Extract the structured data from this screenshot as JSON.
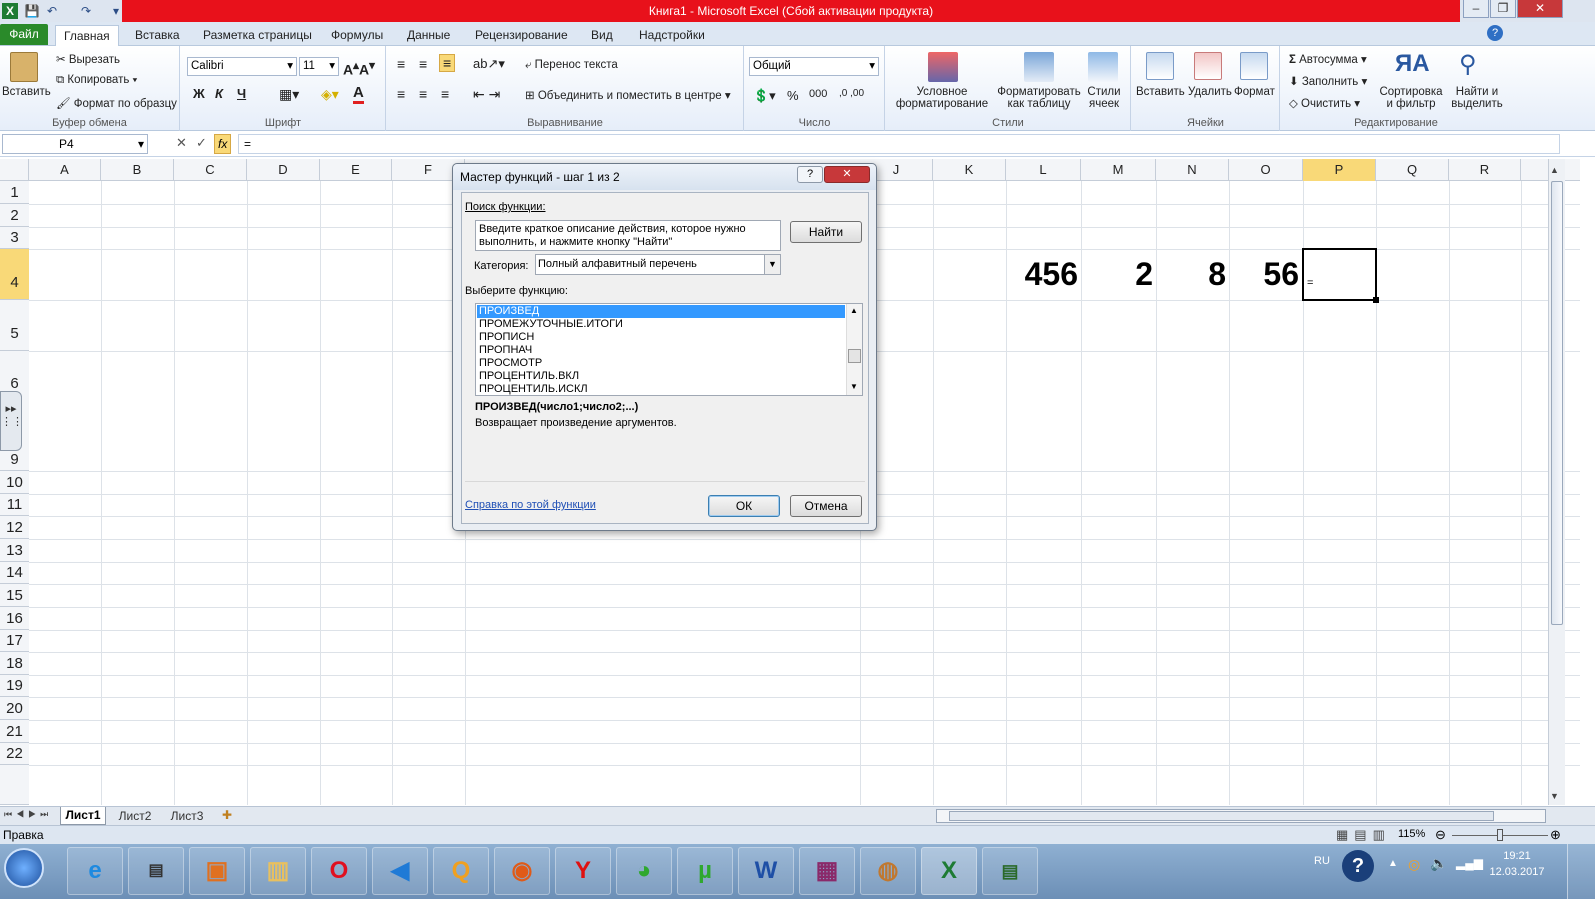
{
  "window": {
    "title": "Книга1  -  Microsoft Excel (Сбой активации продукта)"
  },
  "ribbon_tabs": [
    "Файл",
    "Главная",
    "Вставка",
    "Разметка страницы",
    "Формулы",
    "Данные",
    "Рецензирование",
    "Вид",
    "Надстройки"
  ],
  "clipboard": {
    "paste": "Вставить",
    "cut": "Вырезать",
    "copy": "Копировать",
    "format_painter": "Формат по образцу",
    "label": "Буфер обмена"
  },
  "font": {
    "name": "Calibri",
    "size": "11",
    "bold": "Ж",
    "italic": "К",
    "underline": "Ч",
    "label": "Шрифт"
  },
  "alignment": {
    "wrap": "Перенос текста",
    "merge": "Объединить и поместить в центре",
    "label": "Выравнивание"
  },
  "number": {
    "format": "Общий",
    "percent": "%",
    "thousands": "000",
    "label": "Число"
  },
  "styles": {
    "conditional": "Условное форматирование",
    "as_table": "Форматировать как таблицу",
    "cell_styles": "Стили ячеек",
    "label": "Стили"
  },
  "cells": {
    "insert": "Вставить",
    "delete": "Удалить",
    "format": "Формат",
    "label": "Ячейки"
  },
  "editing": {
    "autosum": "Автосумма",
    "fill": "Заполнить",
    "clear": "Очистить",
    "sort": "Сортировка и фильтр",
    "find": "Найти и выделить",
    "label": "Редактирование"
  },
  "formula_bar": {
    "name_box": "P4",
    "fx": "fx",
    "formula": "="
  },
  "columns": [
    "A",
    "B",
    "C",
    "D",
    "E",
    "F",
    "J",
    "K",
    "L",
    "M",
    "N",
    "O",
    "P",
    "Q",
    "R"
  ],
  "rows": [
    "1",
    "2",
    "3",
    "4",
    "5",
    "6",
    "9",
    "10",
    "11",
    "12",
    "13",
    "14",
    "15",
    "16",
    "17",
    "18",
    "19",
    "20",
    "21",
    "22"
  ],
  "cells_data": {
    "L4": "456",
    "M4": "2",
    "N4": "8",
    "O4": "56",
    "P4": "="
  },
  "dialog": {
    "title": "Мастер функций - шаг 1 из 2",
    "help_btn": "?",
    "close_btn": "✕",
    "search_label": "Поиск функции:",
    "search_text": "Введите краткое описание действия, которое нужно выполнить, и нажмите кнопку \"Найти\"",
    "find_btn": "Найти",
    "category_label": "Категория:",
    "category_value": "Полный алфавитный перечень",
    "select_label": "Выберите функцию:",
    "functions": [
      "ПРОИЗВЕД",
      "ПРОМЕЖУТОЧНЫЕ.ИТОГИ",
      "ПРОПИСН",
      "ПРОПНАЧ",
      "ПРОСМОТР",
      "ПРОЦЕНТИЛЬ.ВКЛ",
      "ПРОЦЕНТИЛЬ.ИСКЛ"
    ],
    "selected_index": 0,
    "signature": "ПРОИЗВЕД(число1;число2;...)",
    "description": "Возвращает произведение аргументов.",
    "help_link": "Справка по этой функции",
    "ok": "ОК",
    "cancel": "Отмена"
  },
  "sheets": [
    "Лист1",
    "Лист2",
    "Лист3"
  ],
  "status": {
    "mode": "Правка",
    "zoom": "115%"
  },
  "tray": {
    "lang": "RU",
    "time": "19:21",
    "date": "12.03.2017"
  }
}
